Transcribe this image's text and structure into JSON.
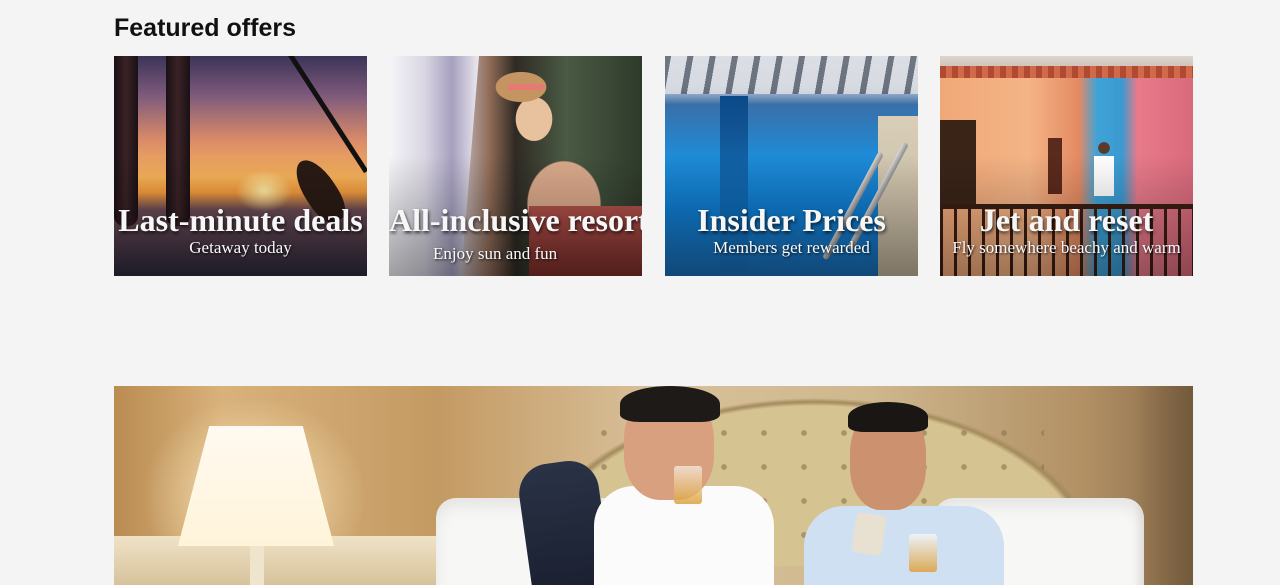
{
  "section": {
    "title": "Featured offers"
  },
  "offers": [
    {
      "title": "Last-minute deals",
      "subtitle": "Getaway today",
      "image": "paddleboard-sunset"
    },
    {
      "title": "All-inclusive resorts",
      "subtitle": "Enjoy sun and fun",
      "image": "woman-cocktail-resort"
    },
    {
      "title": "Insider Prices",
      "subtitle": "Members get rewarded",
      "image": "hotel-pool"
    },
    {
      "title": "Jet and reset",
      "subtitle": "Fly somewhere beachy and warm",
      "image": "colorful-balcony"
    }
  ],
  "hero": {
    "image": "two-men-hotel-bed"
  },
  "colors": {
    "background": "#f4f4f4",
    "heading": "#111111",
    "card_text": "#f7f7f7"
  }
}
